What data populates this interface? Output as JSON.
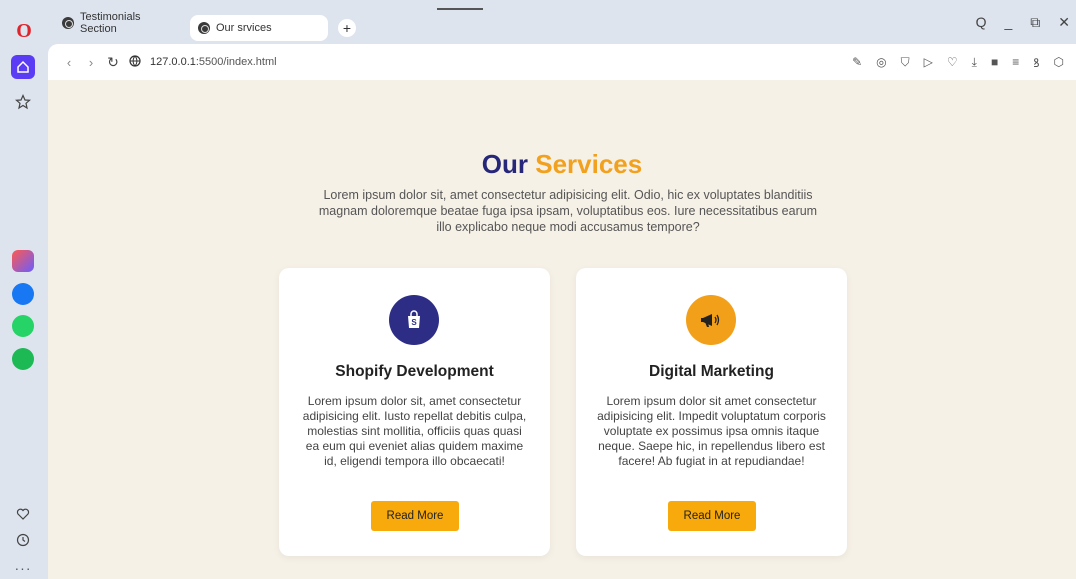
{
  "browser": {
    "tabs": [
      {
        "label": "Testimonials Section"
      },
      {
        "label": "Our srvices"
      }
    ],
    "newtab_label": "+",
    "address": {
      "host": "127.0.0.1",
      "path": ":5500/index.html"
    },
    "window_controls": [
      "Q",
      "_",
      "⧉",
      "✕"
    ]
  },
  "page": {
    "title_word1": "Our",
    "title_word2": "Services",
    "intro": "Lorem ipsum dolor sit, amet consectetur adipisicing elit. Odio, hic ex voluptates blanditiis magnam doloremque beatae fuga ipsa ipsam, voluptatibus eos. Iure necessitatibus earum illo explicabo neque modi accusamus tempore?",
    "cards": [
      {
        "title": "Shopify Development",
        "text": "Lorem ipsum dolor sit, amet consectetur adipisicing elit. Iusto repellat debitis culpa, molestias sint mollitia, officiis quas quasi ea eum qui eveniet alias quidem maxime id, eligendi tempora illo obcaecati!",
        "button": "Read More",
        "icon": "shopify-bag-icon"
      },
      {
        "title": "Digital Marketing",
        "text": "Lorem ipsum dolor sit amet consectetur adipisicing elit. Impedit voluptatum corporis voluptate ex possimus ipsa omnis itaque neque. Saepe hic, in repellendus libero est facere! Ab fugiat in at repudiandae!",
        "button": "Read More",
        "icon": "megaphone-icon"
      }
    ]
  },
  "colors": {
    "title_primary": "#27277a",
    "title_accent": "#f2a11f",
    "button": "#f8aa0c",
    "page_bg": "#f6f1e7"
  }
}
